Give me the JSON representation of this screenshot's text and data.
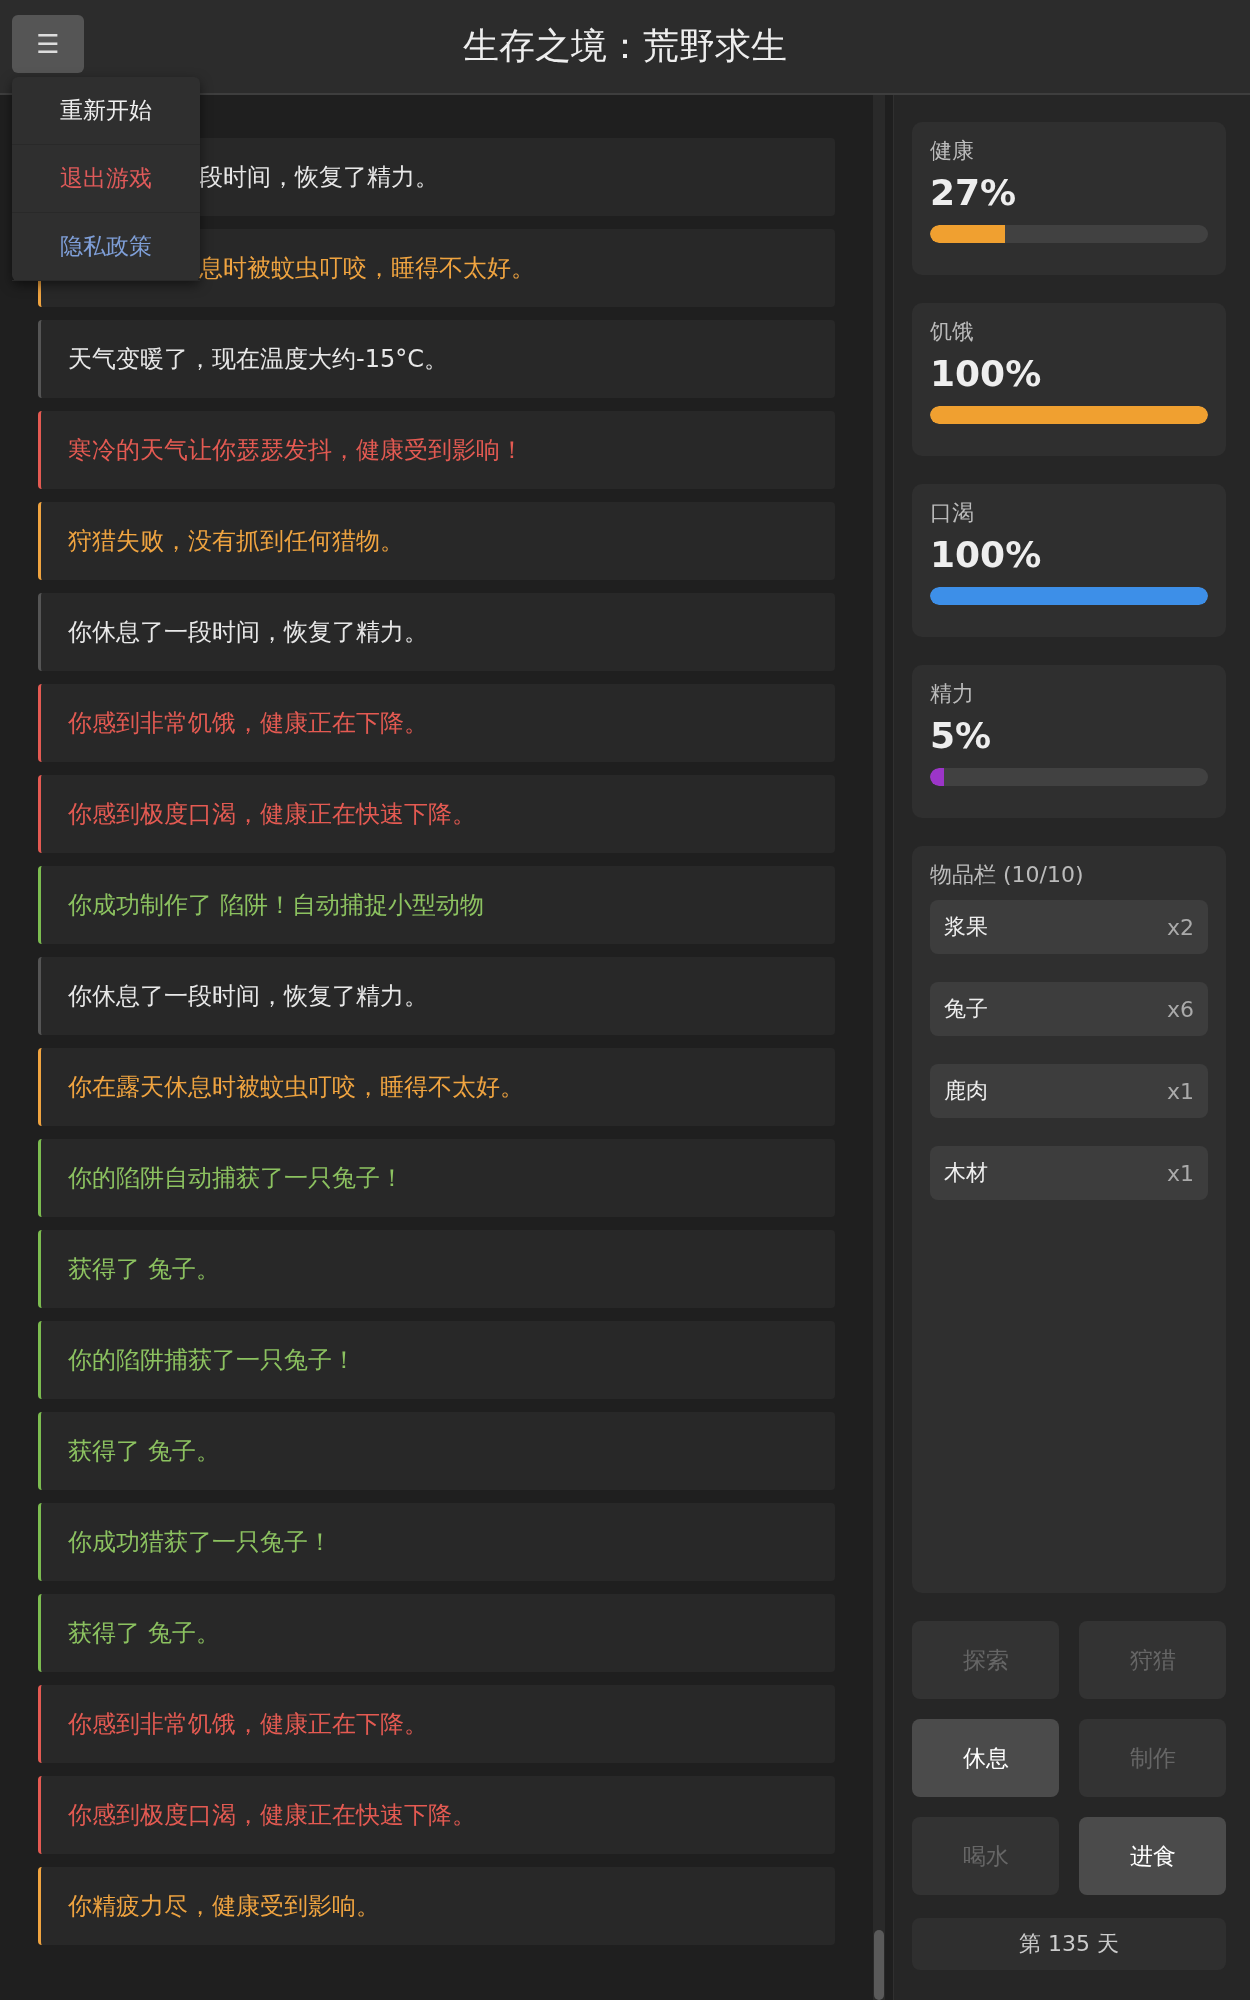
{
  "header": {
    "menu_button": "☰",
    "title": "生存之境：荒野求生"
  },
  "menu": {
    "items": [
      {
        "label": "重新开始",
        "kind": "normal"
      },
      {
        "label": "退出游戏",
        "kind": "danger"
      },
      {
        "label": "隐私政策",
        "kind": "link"
      }
    ]
  },
  "log": [
    {
      "text": "段时间，恢复了精力。",
      "kind": "info",
      "clipped": true
    },
    {
      "text": "息时被蚊虫叮咬，睡得不太好。",
      "kind": "warning",
      "clipped": true
    },
    {
      "text": "天气变暖了，现在温度大约-15°C。",
      "kind": "info",
      "clipped": false
    },
    {
      "text": "寒冷的天气让你瑟瑟发抖，健康受到影响！",
      "kind": "danger",
      "clipped": false
    },
    {
      "text": "狩猎失败，没有抓到任何猎物。",
      "kind": "warning",
      "clipped": false
    },
    {
      "text": "你休息了一段时间，恢复了精力。",
      "kind": "info",
      "clipped": false
    },
    {
      "text": "你感到非常饥饿，健康正在下降。",
      "kind": "danger",
      "clipped": false
    },
    {
      "text": "你感到极度口渴，健康正在快速下降。",
      "kind": "danger",
      "clipped": false
    },
    {
      "text": "你成功制作了 陷阱！自动捕捉小型动物",
      "kind": "success",
      "clipped": false
    },
    {
      "text": "你休息了一段时间，恢复了精力。",
      "kind": "info",
      "clipped": false
    },
    {
      "text": "你在露天休息时被蚊虫叮咬，睡得不太好。",
      "kind": "warning",
      "clipped": false
    },
    {
      "text": "你的陷阱自动捕获了一只兔子！",
      "kind": "success",
      "clipped": false
    },
    {
      "text": "获得了 兔子。",
      "kind": "success",
      "clipped": false
    },
    {
      "text": "你的陷阱捕获了一只兔子！",
      "kind": "success",
      "clipped": false
    },
    {
      "text": "获得了 兔子。",
      "kind": "success",
      "clipped": false
    },
    {
      "text": "你成功猎获了一只兔子！",
      "kind": "success",
      "clipped": false
    },
    {
      "text": "获得了 兔子。",
      "kind": "success",
      "clipped": false
    },
    {
      "text": "你感到非常饥饿，健康正在下降。",
      "kind": "danger",
      "clipped": false
    },
    {
      "text": "你感到极度口渴，健康正在快速下降。",
      "kind": "danger",
      "clipped": false
    },
    {
      "text": "你精疲力尽，健康受到影响。",
      "kind": "warning",
      "clipped": false
    }
  ],
  "stats": [
    {
      "label": "健康",
      "value": "27%",
      "level": 0.27,
      "color": "#f0a030"
    },
    {
      "label": "饥饿",
      "value": "100%",
      "level": 1.0,
      "color": "#f0a030"
    },
    {
      "label": "口渴",
      "value": "100%",
      "level": 1.0,
      "color": "#3d8fe8"
    },
    {
      "label": "精力",
      "value": "5%",
      "level": 0.05,
      "color": "#9c35c8"
    }
  ],
  "inventory": {
    "title": "物品栏 (10/10)",
    "items": [
      {
        "name": "浆果",
        "count": "x2"
      },
      {
        "name": "兔子",
        "count": "x6"
      },
      {
        "name": "鹿肉",
        "count": "x1"
      },
      {
        "name": "木材",
        "count": "x1"
      }
    ]
  },
  "actions": [
    {
      "label": "探索",
      "disabled": true
    },
    {
      "label": "狩猎",
      "disabled": true
    },
    {
      "label": "休息",
      "disabled": false
    },
    {
      "label": "制作",
      "disabled": true
    },
    {
      "label": "喝水",
      "disabled": true
    },
    {
      "label": "进食",
      "disabled": false
    }
  ],
  "day": "第 135 天"
}
